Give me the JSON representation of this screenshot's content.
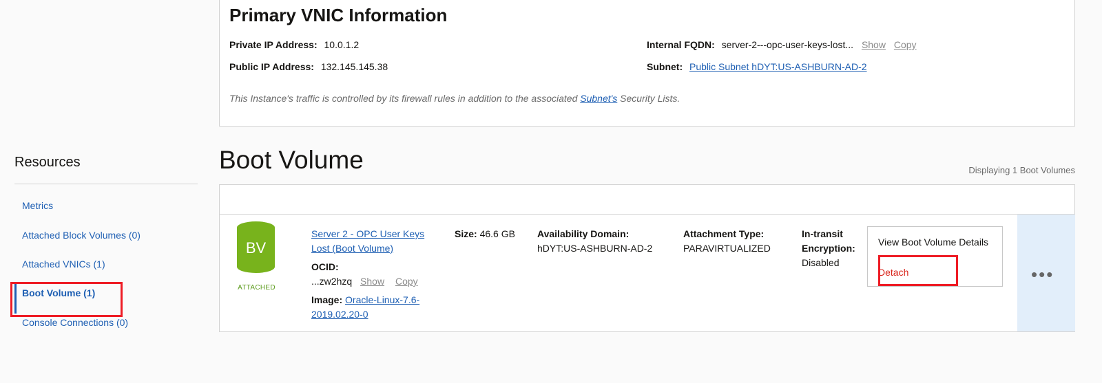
{
  "vnic": {
    "title": "Primary VNIC Information",
    "private_ip_label": "Private IP Address:",
    "private_ip_value": "10.0.1.2",
    "public_ip_label": "Public IP Address:",
    "public_ip_value": "132.145.145.38",
    "fqdn_label": "Internal FQDN:",
    "fqdn_value": "server-2---opc-user-keys-lost...",
    "show_label": "Show",
    "copy_label": "Copy",
    "subnet_label": "Subnet:",
    "subnet_value": "Public Subnet hDYT:US-ASHBURN-AD-2",
    "note_before": "This Instance's traffic is controlled by its firewall rules in addition to the associated ",
    "note_link": "Subnet's",
    "note_after": " Security Lists."
  },
  "resources": {
    "title": "Resources",
    "items": [
      {
        "label": "Metrics"
      },
      {
        "label": "Attached Block Volumes (0)"
      },
      {
        "label": "Attached VNICs (1)"
      },
      {
        "label": "Boot Volume (1)"
      },
      {
        "label": "Console Connections (0)"
      }
    ]
  },
  "boot_volume": {
    "title": "Boot Volume",
    "count_text": "Displaying 1 Boot Volumes",
    "icon_text": "BV",
    "status": "ATTACHED",
    "name_line1": "Server 2 - OPC User Keys",
    "name_line2": "Lost (Boot Volume)",
    "ocid_label": "OCID:",
    "ocid_value": "...zw2hzq",
    "show_label": "Show",
    "copy_label": "Copy",
    "image_label": "Image:",
    "image_line1": "Oracle-Linux-7.6-",
    "image_line2": "2019.02.20-0",
    "size_label": "Size:",
    "size_value": "46.6 GB",
    "ad_label": "Availability Domain:",
    "ad_value": "hDYT:US-ASHBURN-AD-2",
    "attach_label": "Attachment Type:",
    "attach_value": "PARAVIRTUALIZED",
    "encrypt_label1": "In-transit",
    "encrypt_label2": "Encryption:",
    "encrypt_value": "Disabled",
    "menu_view": "View Boot Volume Details",
    "menu_detach": "Detach",
    "more_icon": "•••"
  },
  "colors": {
    "link": "#1e5fb3",
    "danger": "#d9261c",
    "bv_green": "#78b31c",
    "highlight": "#ee1c25"
  }
}
